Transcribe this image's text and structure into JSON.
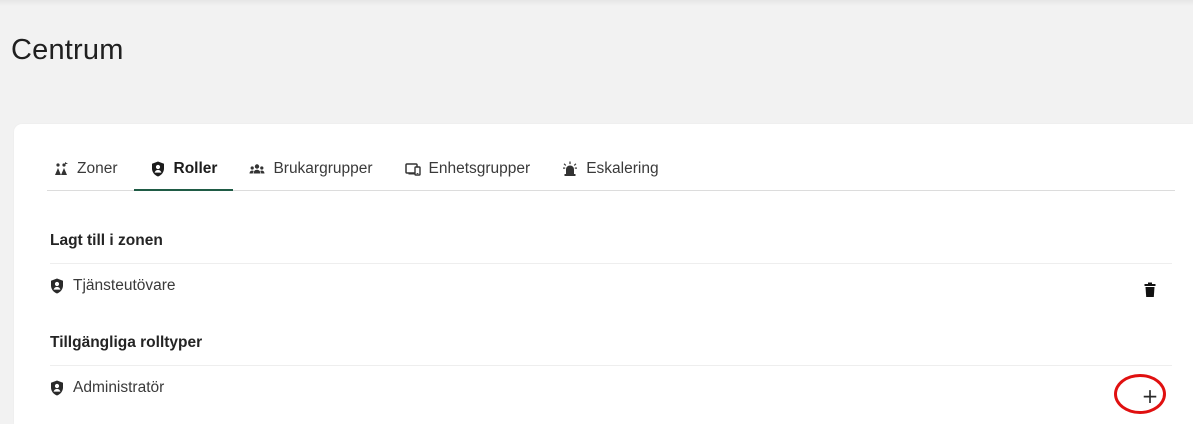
{
  "page": {
    "title": "Centrum"
  },
  "tabs": [
    {
      "label": "Zoner",
      "icon": "zones-icon",
      "active": false
    },
    {
      "label": "Roller",
      "icon": "shield-user-icon",
      "active": true
    },
    {
      "label": "Brukargrupper",
      "icon": "user-group-icon",
      "active": false
    },
    {
      "label": "Enhetsgrupper",
      "icon": "devices-icon",
      "active": false
    },
    {
      "label": "Eskalering",
      "icon": "siren-icon",
      "active": false
    }
  ],
  "added_section": {
    "heading": "Lagt till i zonen",
    "items": [
      {
        "label": "Tjänsteutövare",
        "icon": "shield-user-icon",
        "action_icon": "trash-icon"
      }
    ]
  },
  "available_section": {
    "heading": "Tillgängliga rolltyper",
    "items": [
      {
        "label": "Administratör",
        "icon": "shield-user-icon",
        "action_icon": "plus-icon",
        "action_symbol": "+"
      }
    ]
  },
  "colors": {
    "accent": "#1f5b45",
    "highlight": "#e01010",
    "background": "#f2f2f2"
  }
}
